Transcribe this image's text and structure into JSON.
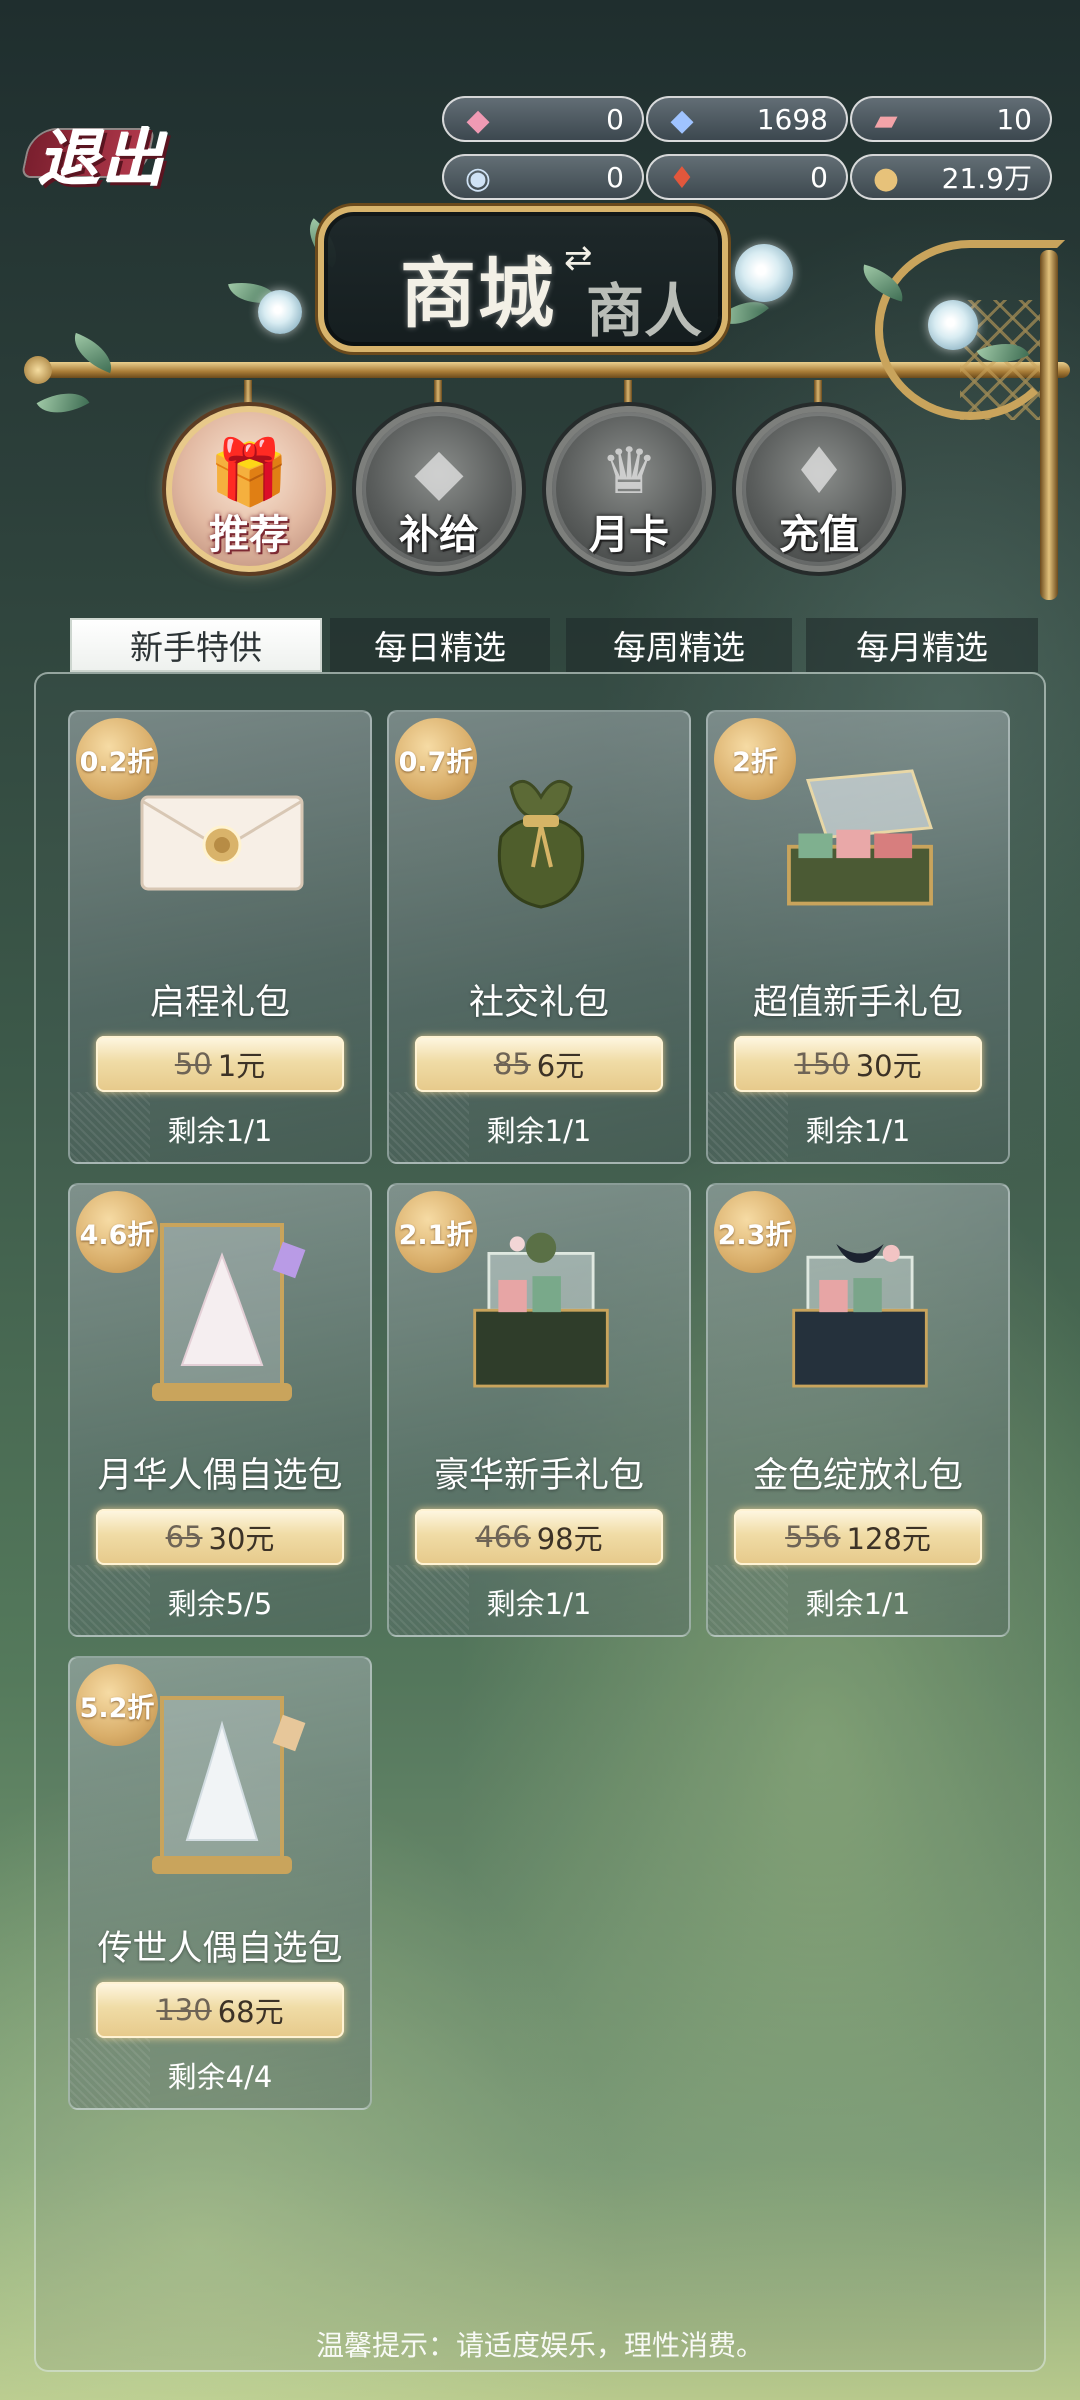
{
  "exit": {
    "label": "退出"
  },
  "currencies": [
    {
      "icon": "pink-crystal-icon",
      "value": "0"
    },
    {
      "icon": "blue-crystal-icon",
      "value": "1698"
    },
    {
      "icon": "pink-ticket-icon",
      "value": "10"
    },
    {
      "icon": "button-token-icon",
      "value": "0"
    },
    {
      "icon": "red-gem-icon",
      "value": "0"
    },
    {
      "icon": "gold-coins-icon",
      "value": "21.9万"
    }
  ],
  "sign": {
    "main": "商城",
    "sub": "商人"
  },
  "categories": [
    {
      "label": "推荐",
      "icon": "gift-box-icon",
      "active": true
    },
    {
      "label": "补给",
      "icon": "crystal-icon",
      "active": false
    },
    {
      "label": "月卡",
      "icon": "crown-card-icon",
      "active": false
    },
    {
      "label": "充值",
      "icon": "gem-icon",
      "active": false
    }
  ],
  "tabs": [
    {
      "label": "新手特供",
      "active": true
    },
    {
      "label": "每日精选",
      "active": false
    },
    {
      "label": "每周精选",
      "active": false
    },
    {
      "label": "每月精选",
      "active": false
    }
  ],
  "products": [
    {
      "discount": "0.2折",
      "name": "启程礼包",
      "old_price": "50",
      "price": "1元",
      "stock": "剩余1/1",
      "icon": "envelope-icon"
    },
    {
      "discount": "0.7折",
      "name": "社交礼包",
      "old_price": "85",
      "price": "6元",
      "stock": "剩余1/1",
      "icon": "cloth-pouch-icon"
    },
    {
      "discount": "2折",
      "name": "超值新手礼包",
      "old_price": "150",
      "price": "30元",
      "stock": "剩余1/1",
      "icon": "open-gift-box-icon"
    },
    {
      "discount": "4.6折",
      "name": "月华人偶自选包",
      "old_price": "65",
      "price": "30元",
      "stock": "剩余5/5",
      "icon": "doll-dress-case-icon"
    },
    {
      "discount": "2.1折",
      "name": "豪华新手礼包",
      "old_price": "466",
      "price": "98元",
      "stock": "剩余1/1",
      "icon": "green-gift-chest-icon"
    },
    {
      "discount": "2.3折",
      "name": "金色绽放礼包",
      "old_price": "556",
      "price": "128元",
      "stock": "剩余1/1",
      "icon": "navy-gift-chest-icon"
    },
    {
      "discount": "5.2折",
      "name": "传世人偶自选包",
      "old_price": "130",
      "price": "68元",
      "stock": "剩余4/4",
      "icon": "doll-gown-case-icon"
    }
  ],
  "footer": {
    "tip": "温馨提示：请适度娱乐，理性消费。"
  }
}
